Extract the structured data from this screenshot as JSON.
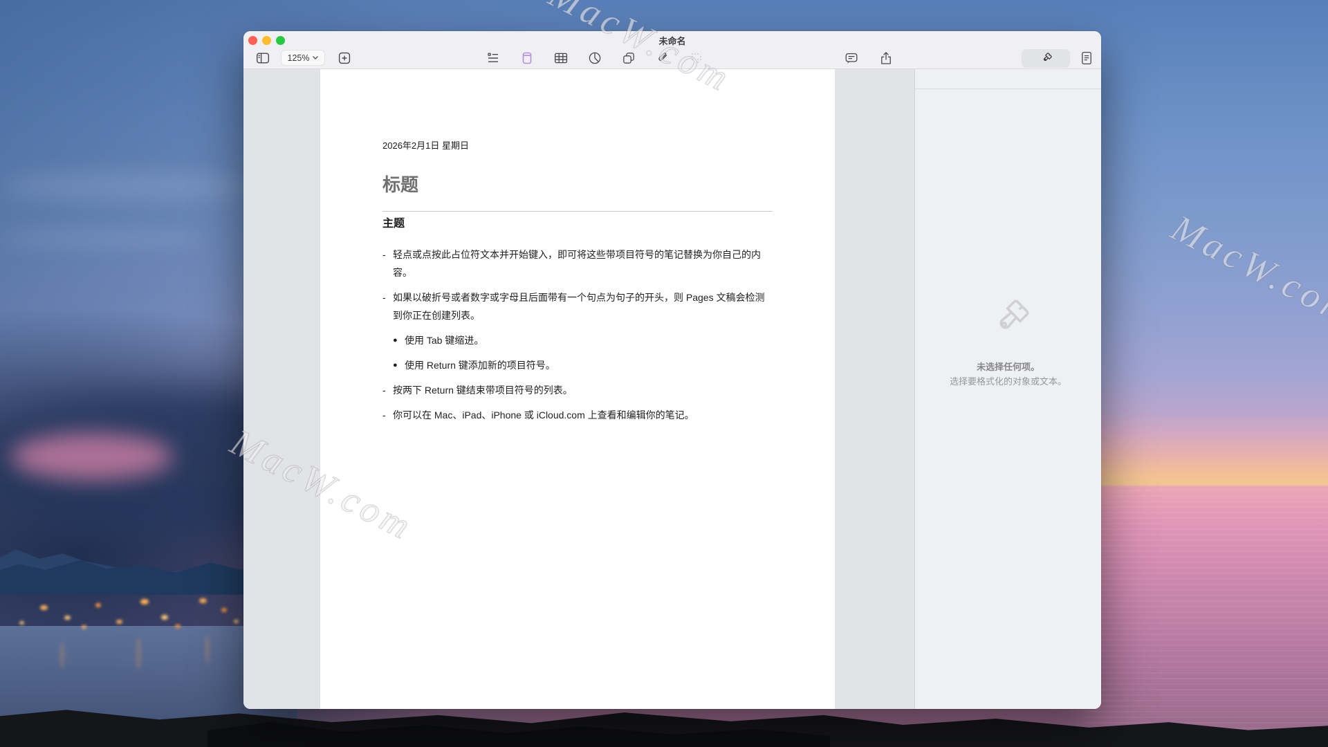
{
  "app": "Pages",
  "window": {
    "title": "未命名",
    "traffic_lights": [
      "close",
      "minimize",
      "zoom"
    ]
  },
  "toolbar": {
    "zoom_value": "125%",
    "icons": [
      "sidebar-toggle",
      "zoom-dropdown",
      "insert-plus",
      "view-list",
      "text-note",
      "table",
      "chart-pie",
      "shapes",
      "attachment",
      "collaborate",
      "comment",
      "share",
      "format-brush",
      "document"
    ]
  },
  "document": {
    "date": "2026年2月1日 星期日",
    "title_placeholder": "标题",
    "section_heading": "主题",
    "bullets": [
      {
        "level": 1,
        "marker": "-",
        "text": "轻点或点按此占位符文本并开始键入，即可将这些带项目符号的笔记替换为你自己的内容。"
      },
      {
        "level": 1,
        "marker": "-",
        "text": "如果以破折号或者数字或字母且后面带有一个句点为句子的开头，则 Pages 文稿会检测到你正在创建列表。"
      },
      {
        "level": 2,
        "marker": "●",
        "text": "使用 Tab 键缩进。"
      },
      {
        "level": 2,
        "marker": "●",
        "text": "使用 Return 键添加新的项目符号。"
      },
      {
        "level": 1,
        "marker": "-",
        "text": "按两下 Return 键结束带项目符号的列表。"
      },
      {
        "level": 1,
        "marker": "-",
        "text": "你可以在 Mac、iPad、iPhone 或 iCloud.com 上查看和编辑你的笔记。"
      }
    ]
  },
  "sidebar": {
    "empty_state_title": "未选择任何项。",
    "empty_state_subtitle": "选择要格式化的对象或文本。"
  },
  "watermarks": [
    {
      "text": "MacW.com"
    },
    {
      "text": "MacW.com"
    },
    {
      "text": "MacW.com"
    }
  ],
  "colors": {
    "accent_purple": "#b48ce0",
    "traffic_red": "#ff5f57",
    "traffic_yellow": "#febc2e",
    "traffic_green": "#28c840",
    "toolbar_bg": "#f0f0f2",
    "canvas_gray": "#e2e3e6",
    "sidebar_bg": "#eef0f2"
  }
}
